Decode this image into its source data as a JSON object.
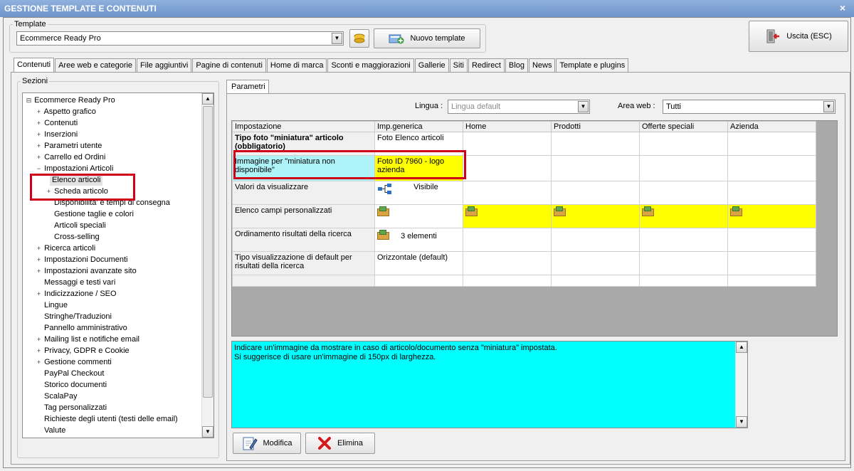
{
  "window": {
    "title": "GESTIONE TEMPLATE E CONTENUTI",
    "close_glyph": "×"
  },
  "template": {
    "legend": "Template",
    "selected": "Ecommerce Ready Pro",
    "new_button": "Nuovo template"
  },
  "exit_button": "Uscita (ESC)",
  "tabs": [
    "Contenuti",
    "Aree web e categorie",
    "File aggiuntivi",
    "Pagine di contenuti",
    "Home di marca",
    "Sconti e maggiorazioni",
    "Gallerie",
    "Siti",
    "Redirect",
    "Blog",
    "News",
    "Template e plugins"
  ],
  "sections": {
    "legend": "Sezioni",
    "items": [
      {
        "label": "Ecommerce Ready Pro",
        "expander": "⊟"
      },
      {
        "label": "Aspetto grafico",
        "expander": "+"
      },
      {
        "label": "Contenuti",
        "expander": "+"
      },
      {
        "label": "Inserzioni",
        "expander": "+"
      },
      {
        "label": "Parametri utente",
        "expander": "+"
      },
      {
        "label": "Carrello ed Ordini",
        "expander": "+"
      },
      {
        "label": "Impostazioni Articoli",
        "expander": "−"
      },
      {
        "label": "Elenco articoli",
        "expander": ""
      },
      {
        "label": "Scheda articolo",
        "expander": "+"
      },
      {
        "label": "Disponibilita' e tempi di consegna",
        "expander": ""
      },
      {
        "label": "Gestione taglie e colori",
        "expander": ""
      },
      {
        "label": "Articoli speciali",
        "expander": ""
      },
      {
        "label": "Cross-selling",
        "expander": ""
      },
      {
        "label": "Ricerca articoli",
        "expander": "+"
      },
      {
        "label": "Impostazioni Documenti",
        "expander": "+"
      },
      {
        "label": "Impostazioni avanzate sito",
        "expander": "+"
      },
      {
        "label": "Messaggi e testi vari",
        "expander": ""
      },
      {
        "label": "Indicizzazione / SEO",
        "expander": "+"
      },
      {
        "label": "Lingue",
        "expander": ""
      },
      {
        "label": "Stringhe/Traduzioni",
        "expander": ""
      },
      {
        "label": "Pannello amministrativo",
        "expander": ""
      },
      {
        "label": "Mailing list e notifiche email",
        "expander": "+"
      },
      {
        "label": "Privacy, GDPR e Cookie",
        "expander": "+"
      },
      {
        "label": "Gestione commenti",
        "expander": "+"
      },
      {
        "label": "PayPal Checkout",
        "expander": ""
      },
      {
        "label": "Storico documenti",
        "expander": ""
      },
      {
        "label": "ScalaPay",
        "expander": ""
      },
      {
        "label": "Tag personalizzati",
        "expander": ""
      },
      {
        "label": "Richieste degli utenti (testi delle email)",
        "expander": ""
      },
      {
        "label": "Valute",
        "expander": ""
      }
    ]
  },
  "params": {
    "tab": "Parametri",
    "lingua_label": "Lingua :",
    "lingua_value": "Lingua default",
    "area_label": "Area web :",
    "area_value": "Tutti",
    "headers": [
      "Impostazione",
      "Imp.generica",
      "Home",
      "Prodotti",
      "Offerte speciali",
      "Azienda"
    ],
    "rows": [
      {
        "name": "Tipo foto \"miniatura\" articolo (obbligatorio)",
        "value": "Foto Elenco articoli"
      },
      {
        "name": "Immagine per \"miniatura non disponibile\"",
        "value": "Foto ID 7960 - logo azienda"
      },
      {
        "name": "Valori da visualizzare",
        "value": "Visibile"
      },
      {
        "name": "Elenco campi personalizzati",
        "value": ""
      },
      {
        "name": "Ordinamento risultati della ricerca",
        "value": "3 elementi"
      },
      {
        "name": "Tipo visualizzazione di default per risultati della ricerca",
        "value": "Orizzontale (default)"
      }
    ],
    "description_line1": "Indicare un'immagine da mostrare in caso di articolo/documento senza \"miniatura\" impostata.",
    "description_line2": "Si suggerisce di usare un'immagine di 150px di larghezza.",
    "edit_button": "Modifica",
    "delete_button": "Elimina"
  },
  "colors": {
    "highlight_red": "#d00018",
    "cyan": "#00ffff",
    "yellow": "#ffff00",
    "light_cyan": "#aef3f7"
  }
}
